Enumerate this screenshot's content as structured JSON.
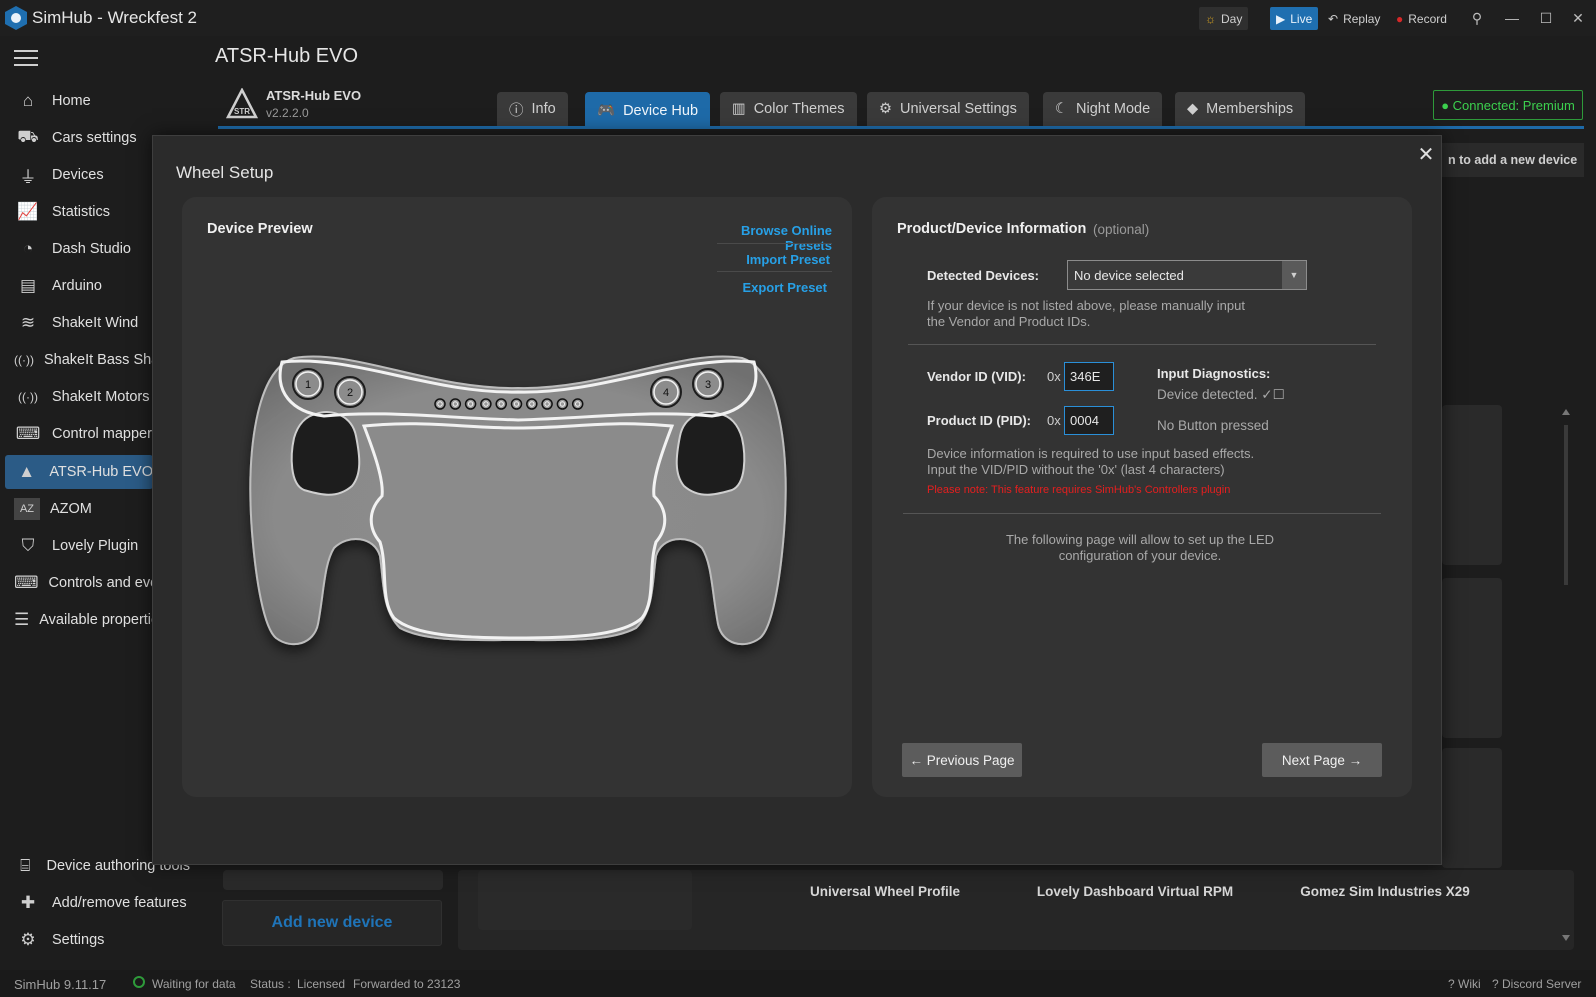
{
  "window": {
    "title": "SimHub - Wreckfest 2",
    "day_label": "Day",
    "live_label": "Live",
    "replay_label": "Replay",
    "record_label": "Record"
  },
  "sidebar": {
    "items": [
      {
        "label": "Home",
        "icon": "home-icon"
      },
      {
        "label": "Cars settings",
        "icon": "car-icon"
      },
      {
        "label": "Devices",
        "icon": "usb-icon"
      },
      {
        "label": "Statistics",
        "icon": "chart-icon"
      },
      {
        "label": "Dash Studio",
        "icon": "gauge-icon"
      },
      {
        "label": "Arduino",
        "icon": "arduino-icon"
      },
      {
        "label": "ShakeIt Wind",
        "icon": "wind-icon"
      },
      {
        "label": "ShakeIt Bass Shakers",
        "icon": "vibration-icon"
      },
      {
        "label": "ShakeIt Motors",
        "icon": "vibration-icon"
      },
      {
        "label": "Control mapper",
        "icon": "controller-icon"
      },
      {
        "label": "ATSR-Hub EVO",
        "icon": "atsr-icon"
      },
      {
        "label": "AZOM",
        "icon": "azom-icon"
      },
      {
        "label": "Lovely Plugin",
        "icon": "lovely-icon"
      },
      {
        "label": "Controls and events",
        "icon": "keyboard-icon"
      },
      {
        "label": "Available properties",
        "icon": "list-icon"
      }
    ],
    "bottom_items": [
      {
        "label": "Device authoring tools",
        "icon": "toolbox-icon"
      },
      {
        "label": "Add/remove features",
        "icon": "puzzle-icon"
      },
      {
        "label": "Settings",
        "icon": "gear-icon"
      }
    ]
  },
  "plugin": {
    "title": "ATSR-Hub EVO",
    "name": "ATSR-Hub EVO",
    "version": "v2.2.2.0",
    "connection": "● Connected: Premium",
    "tabs": [
      {
        "label": "Info",
        "icon": "info-icon"
      },
      {
        "label": "Device Hub",
        "icon": "gamepad-icon"
      },
      {
        "label": "Color Themes",
        "icon": "palette-icon"
      },
      {
        "label": "Universal Settings",
        "icon": "gear-icon"
      },
      {
        "label": "Night Mode",
        "icon": "moon-icon"
      },
      {
        "label": "Memberships",
        "icon": "diamond-icon"
      }
    ]
  },
  "background": {
    "hint": "n to add a new device",
    "add_device_label": "Add new device",
    "cards": [
      "Universal Wheel Profile",
      "Lovely Dashboard Virtual RPM",
      "Gomez Sim Industries X29"
    ]
  },
  "modal": {
    "title": "Wheel Setup",
    "preview": {
      "heading": "Device Preview",
      "browse_presets": "Browse Online Presets",
      "import_preset": "Import Preset",
      "export_preset": "Export Preset",
      "buttons": [
        "1",
        "2",
        "4",
        "3"
      ],
      "led_count": 10
    },
    "info": {
      "heading": "Product/Device Information",
      "optional": "(optional)",
      "detected_label": "Detected Devices:",
      "detected_value": "No device selected",
      "manual_hint_1": "If your device is not listed above, please manually input",
      "manual_hint_2": "the Vendor and Product IDs.",
      "vid_label": "Vendor ID (VID):",
      "pid_label": "Product ID (PID):",
      "hex_prefix": "0x",
      "vid_value": "346E",
      "pid_value": "0004",
      "diag_label": "Input Diagnostics:",
      "diag_detected": "Device detected. ✓☐",
      "diag_buttons": "No Button pressed",
      "req_hint_1": "Device information is required to use input based effects.",
      "req_hint_2": "Input the VID/PID without the '0x' (last 4 characters)",
      "note": "Please note: This feature requires SimHub's Controllers plugin",
      "next_hint_1": "The following page will allow to set up the LED",
      "next_hint_2": "configuration of your device.",
      "prev_label": "← Previous Page",
      "next_label": "Next Page →"
    }
  },
  "status": {
    "version": "SimHub 9.11.17",
    "waiting": "Waiting for data",
    "status_label": "Status :",
    "licensed": "Licensed",
    "forwarded": "Forwarded to 23123",
    "wiki": "Wiki",
    "discord": "Discord Server"
  },
  "colors": {
    "accent": "#1e6aa8",
    "link": "#27a0e6",
    "connected": "#3ccf4e",
    "warning": "#e51f1f",
    "record": "#d62828"
  }
}
